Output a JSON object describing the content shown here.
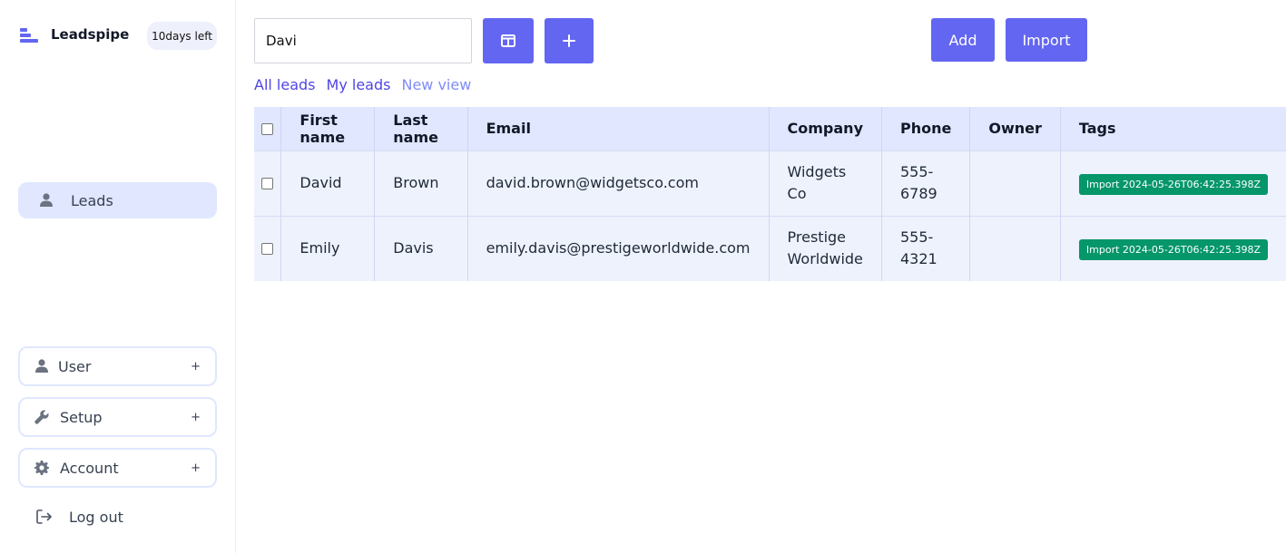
{
  "sidebar": {
    "brand": "Leadspipe",
    "trial_badge": "10days left",
    "nav": {
      "leads_label": "Leads"
    },
    "buttons": {
      "user": {
        "label": "User",
        "plus": "+"
      },
      "setup": {
        "label": "Setup",
        "plus": "+"
      },
      "account": {
        "label": "Account",
        "plus": "+"
      }
    },
    "logout_label": "Log out"
  },
  "toolbar": {
    "search_value": "Davi",
    "add_label": "Add",
    "import_label": "Import",
    "layout_icon": "columns-icon",
    "plus_icon": "plus-icon"
  },
  "views": {
    "all": "All leads",
    "mine": "My leads",
    "new": "New view"
  },
  "table": {
    "headers": {
      "first_name": "First name",
      "last_name": "Last name",
      "email": "Email",
      "company": "Company",
      "phone": "Phone",
      "owner": "Owner",
      "tags": "Tags"
    },
    "rows": [
      {
        "first_name": "David",
        "last_name": "Brown",
        "email": "david.brown@widgetsco.com",
        "company_line1": "Widgets",
        "company_line2": "Co",
        "phone_line1": "555-",
        "phone_line2": "6789",
        "owner": "",
        "tag": "Import 2024-05-26T06:42:25.398Z"
      },
      {
        "first_name": "Emily",
        "last_name": "Davis",
        "email": "emily.davis@prestigeworldwide.com",
        "company_line1": "Prestige",
        "company_line2": "Worldwide",
        "phone_line1": "555-",
        "phone_line2": "4321",
        "owner": "",
        "tag": "Import 2024-05-26T06:42:25.398Z"
      }
    ]
  },
  "colors": {
    "accent": "#6366f1",
    "accent_light": "#e0e7ff",
    "row_bg": "#eef2fd",
    "tag_green": "#059669"
  }
}
